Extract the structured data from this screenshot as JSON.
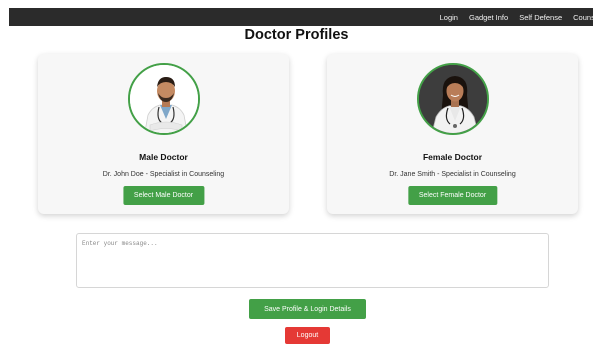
{
  "nav": {
    "items": [
      {
        "label": "Login"
      },
      {
        "label": "Gadget Info"
      },
      {
        "label": "Self Defense"
      },
      {
        "label": "Counse"
      }
    ]
  },
  "page": {
    "title": "Doctor Profiles"
  },
  "doctors": {
    "male": {
      "title": "Male Doctor",
      "description": "Dr. John Doe - Specialist in Counseling",
      "button_label": "Select Male Doctor"
    },
    "female": {
      "title": "Female Doctor",
      "description": "Dr. Jane Smith - Specialist in Counseling",
      "button_label": "Select Female Doctor"
    }
  },
  "message": {
    "placeholder": "Enter your message..."
  },
  "actions": {
    "save_label": "Save Profile & Login Details",
    "logout_label": "Logout"
  },
  "colors": {
    "nav_bg": "#2b2b2b",
    "accent_green": "#43a047",
    "logout_red": "#e53935",
    "card_bg": "#f7f7f7"
  }
}
